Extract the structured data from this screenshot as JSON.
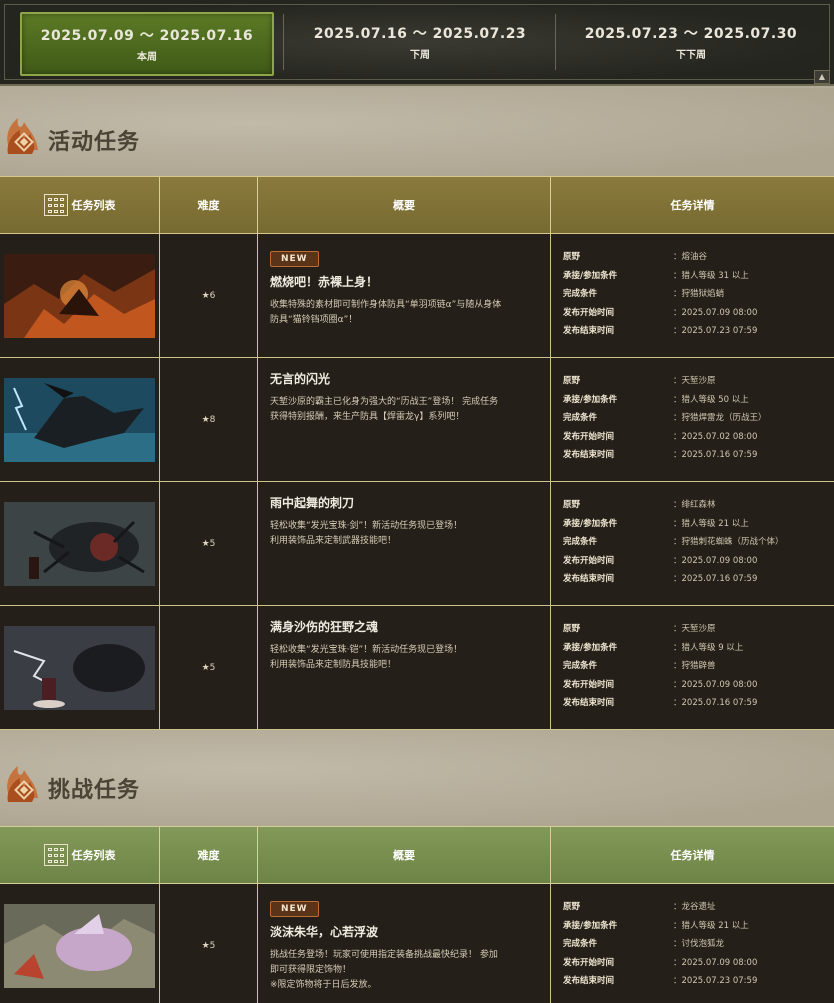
{
  "weeks": [
    {
      "range": "2025.07.09 〜 2025.07.16",
      "label": "本周",
      "active": true
    },
    {
      "range": "2025.07.16 〜 2025.07.23",
      "label": "下周",
      "active": false
    },
    {
      "range": "2025.07.23 〜 2025.07.30",
      "label": "下下周",
      "active": false
    }
  ],
  "sections": [
    {
      "title": "活动任务",
      "header_color": "gold",
      "columns": [
        "任务列表",
        "难度",
        "概要",
        "任务详情"
      ],
      "quests": [
        {
          "new": true,
          "stars": "★6",
          "title": "燃烧吧！赤裸上身！",
          "desc": "收集特殊的素材即可制作身体防具“单羽项链α”与随从身体\n防具“猫铃铛项圈α”！",
          "details": [
            [
              "原野",
              "：熔油谷"
            ],
            [
              "承接/参加条件",
              "：猎人等级 31 以上"
            ],
            [
              "完成条件",
              "：狩猎狱焰蛸"
            ],
            [
              "发布开始时间",
              "：2025.07.09 08:00"
            ],
            [
              "发布结束时间",
              "：2025.07.23 07:59"
            ]
          ]
        },
        {
          "new": false,
          "stars": "★8",
          "title": "无言的闪光",
          "desc": "天堑沙原的霸主已化身为强大的“历战王”登场！ 完成任务\n获得特别报酬，来生产防具【焊雷龙γ】系列吧！",
          "details": [
            [
              "原野",
              "：天堑沙原"
            ],
            [
              "承接/参加条件",
              "：猎人等级 50 以上"
            ],
            [
              "完成条件",
              "：狩猎焊雷龙（历战王）"
            ],
            [
              "发布开始时间",
              "：2025.07.02 08:00"
            ],
            [
              "发布结束时间",
              "：2025.07.16 07:59"
            ]
          ]
        },
        {
          "new": false,
          "stars": "★5",
          "title": "雨中起舞的刺刀",
          "desc": "轻松收集“发光宝珠·剑”！新活动任务现已登场！\n利用装饰品来定制武器技能吧！",
          "details": [
            [
              "原野",
              "：绯红森林"
            ],
            [
              "承接/参加条件",
              "：猎人等级 21 以上"
            ],
            [
              "完成条件",
              "：狩猎刺花蜘蛛（历战个体）"
            ],
            [
              "发布开始时间",
              "：2025.07.09 08:00"
            ],
            [
              "发布结束时间",
              "：2025.07.16 07:59"
            ]
          ]
        },
        {
          "new": false,
          "stars": "★5",
          "title": "满身沙伤的狂野之魂",
          "desc": "轻松收集“发光宝珠·铠”！新活动任务现已登场！\n利用装饰品来定制防具技能吧！",
          "details": [
            [
              "原野",
              "：天堑沙原"
            ],
            [
              "承接/参加条件",
              "：猎人等级 9 以上"
            ],
            [
              "完成条件",
              "：狩猎辟兽"
            ],
            [
              "发布开始时间",
              "：2025.07.09 08:00"
            ],
            [
              "发布结束时间",
              "：2025.07.16 07:59"
            ]
          ]
        }
      ]
    },
    {
      "title": "挑战任务",
      "header_color": "green",
      "columns": [
        "任务列表",
        "难度",
        "概要",
        "任务详情"
      ],
      "quests": [
        {
          "new": true,
          "stars": "★5",
          "title": "淡沫朱华，心若浮波",
          "desc": "挑战任务登场！玩家可使用指定装备挑战最快纪录！ 参加\n即可获得限定饰物！\n※限定饰物将于日后发放。",
          "details": [
            [
              "原野",
              "：龙谷遗址"
            ],
            [
              "承接/参加条件",
              "：猎人等级 21 以上"
            ],
            [
              "完成条件",
              "：讨伐泡狐龙"
            ],
            [
              "发布开始时间",
              "：2025.07.09 08:00"
            ],
            [
              "发布结束时间",
              "：2025.07.23 07:59"
            ]
          ]
        }
      ]
    }
  ],
  "new_label": "NEW",
  "colors": {
    "active_week": "#4e6b1f",
    "gold_header": "#85773a",
    "green_header": "#7a9050",
    "row_bg": "#241f18",
    "accent_orange": "#c8692c"
  }
}
